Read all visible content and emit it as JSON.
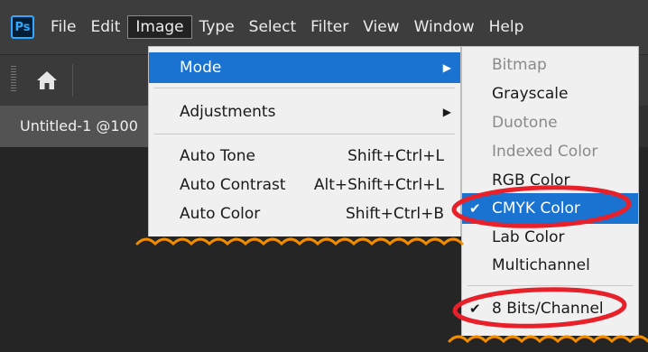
{
  "app": {
    "logo": "Ps"
  },
  "menubar": {
    "items": [
      {
        "label": "File"
      },
      {
        "label": "Edit"
      },
      {
        "label": "Image"
      },
      {
        "label": "Type"
      },
      {
        "label": "Select"
      },
      {
        "label": "Filter"
      },
      {
        "label": "View"
      },
      {
        "label": "Window"
      },
      {
        "label": "Help"
      }
    ]
  },
  "document_tab": {
    "title": "Untitled-1 @100"
  },
  "image_menu": {
    "mode": "Mode",
    "adjustments": "Adjustments",
    "auto_tone": {
      "label": "Auto Tone",
      "shortcut": "Shift+Ctrl+L"
    },
    "auto_contrast": {
      "label": "Auto Contrast",
      "shortcut": "Alt+Shift+Ctrl+L"
    },
    "auto_color": {
      "label": "Auto Color",
      "shortcut": "Shift+Ctrl+B"
    }
  },
  "mode_menu": {
    "items": [
      {
        "label": "Bitmap",
        "enabled": false
      },
      {
        "label": "Grayscale",
        "enabled": true
      },
      {
        "label": "Duotone",
        "enabled": false
      },
      {
        "label": "Indexed Color",
        "enabled": false
      },
      {
        "label": "RGB Color",
        "enabled": true
      },
      {
        "label": "CMYK Color",
        "enabled": true,
        "checked": true
      },
      {
        "label": "Lab Color",
        "enabled": true
      },
      {
        "label": "Multichannel",
        "enabled": true
      },
      {
        "label": "8 Bits/Channel",
        "enabled": true,
        "checked": true
      }
    ],
    "check_glyph": "✔"
  },
  "colors": {
    "highlight": "#1a72d1",
    "annotation": "#e8202a",
    "torn_edge": "#f28c00"
  }
}
